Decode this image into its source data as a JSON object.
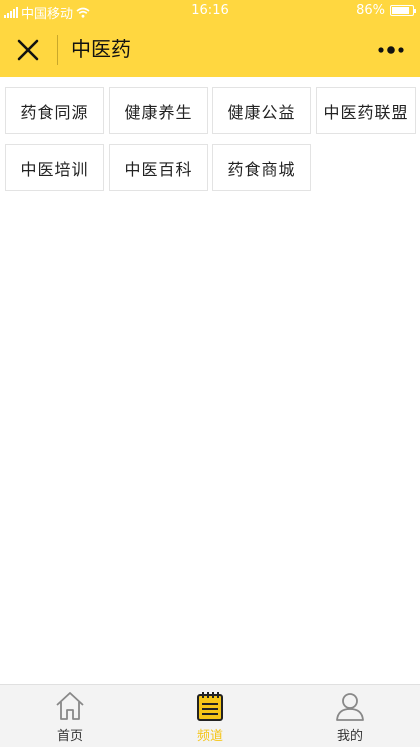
{
  "status_bar": {
    "carrier": "中国移动",
    "time": "16:16",
    "battery": "86%",
    "battery_level": 0.86
  },
  "nav": {
    "title": "中医药",
    "close_icon": "close-icon",
    "more_icon": "more-icon"
  },
  "tags": [
    {
      "label": "药食同源"
    },
    {
      "label": "健康养生"
    },
    {
      "label": "健康公益"
    },
    {
      "label": "中医药联盟"
    },
    {
      "label": "中医培训"
    },
    {
      "label": "中医百科"
    },
    {
      "label": "药食商城"
    }
  ],
  "tab_bar": {
    "tabs": [
      {
        "label": "首页",
        "icon": "home-icon"
      },
      {
        "label": "频道",
        "icon": "notepad-icon",
        "active": true
      },
      {
        "label": "我的",
        "icon": "user-icon"
      }
    ]
  },
  "colors": {
    "brand": "#ffd740",
    "active_tab": "#f5c518"
  }
}
